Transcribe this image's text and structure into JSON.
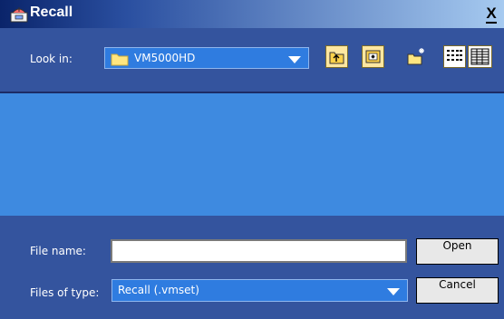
{
  "window": {
    "title": "Recall",
    "close_label": "X"
  },
  "toolbar": {
    "look_in_label": "Look in:",
    "look_in_value": "VM5000HD",
    "buttons": [
      "up-one-level-icon",
      "desktop-icon",
      "new-folder-icon",
      "list-view-icon",
      "details-view-icon"
    ]
  },
  "form": {
    "file_name_label": "File name:",
    "file_name_value": "",
    "files_of_type_label": "Files of type:",
    "files_of_type_value": "Recall (.vmset)",
    "open_label": "Open",
    "cancel_label": "Cancel"
  },
  "colors": {
    "titlebar": "#0a246a",
    "panel": "#34549e",
    "list": "#3e8ae0",
    "combo": "#2f7ce0",
    "toolbar_button": "#ffe7a0"
  }
}
